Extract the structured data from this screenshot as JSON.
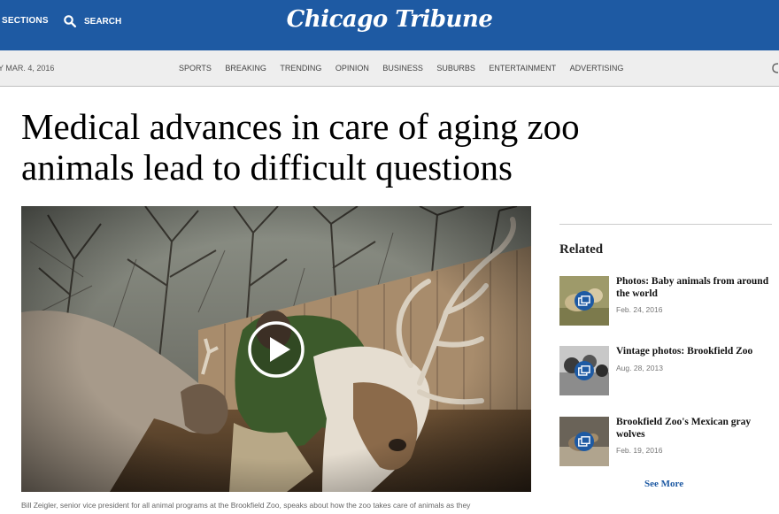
{
  "header": {
    "sections_label": "SECTIONS",
    "search_label": "SEARCH",
    "logo_text": "Chicago Tribune",
    "accent_color": "#1e5aa3"
  },
  "navbar": {
    "date": "Y MAR. 4, 2016",
    "links": [
      "SPORTS",
      "BREAKING",
      "TRENDING",
      "OPINION",
      "BUSINESS",
      "SUBURBS",
      "ENTERTAINMENT",
      "ADVERTISING"
    ]
  },
  "article": {
    "headline_line1": "Medical advances in care of aging zoo",
    "headline_line2": "animals lead to difficult questions",
    "caption": "Bill Zeigler, senior vice president for all animal programs at the Brookfield Zoo, speaks about how the zoo takes care of animals as they"
  },
  "related": {
    "title": "Related",
    "items": [
      {
        "headline": "Photos: Baby animals from around the world",
        "date": "Feb. 24, 2016",
        "icon": "gallery-icon"
      },
      {
        "headline": "Vintage photos: Brookfield Zoo",
        "date": "Aug. 28, 2013",
        "icon": "gallery-icon"
      },
      {
        "headline": "Brookfield Zoo's Mexican gray wolves",
        "date": "Feb. 19, 2016",
        "icon": "gallery-icon"
      }
    ],
    "see_more": "See More"
  }
}
